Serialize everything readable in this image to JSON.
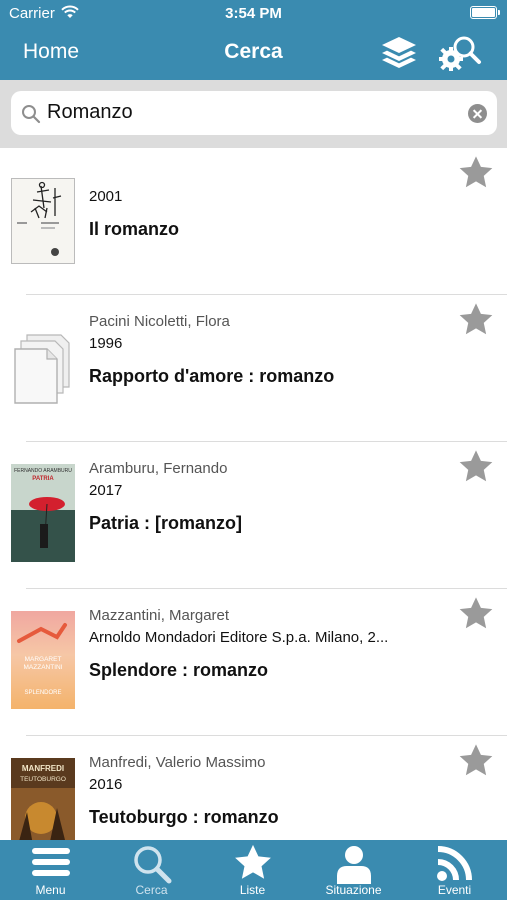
{
  "status_bar": {
    "carrier": "Carrier",
    "time": "3:54 PM"
  },
  "nav": {
    "back_label": "Home",
    "title": "Cerca"
  },
  "search": {
    "value": "Romanzo"
  },
  "results": [
    {
      "author": "",
      "year": "2001",
      "title": "Il romanzo"
    },
    {
      "author": "Pacini Nicoletti, Flora",
      "year": "1996",
      "title": "Rapporto d'amore : romanzo"
    },
    {
      "author": "Aramburu, Fernando",
      "year": "2017",
      "title": "Patria : [romanzo]"
    },
    {
      "author": "Mazzantini, Margaret",
      "year": "Arnoldo Mondadori Editore S.p.a. Milano, 2...",
      "title": "Splendore : romanzo"
    },
    {
      "author": "Manfredi, Valerio Massimo",
      "year": "2016",
      "title": "Teutoburgo : romanzo"
    }
  ],
  "covers": {
    "c3_author": "FERNANDO ARAMBURU",
    "c3_title": "PATRIA",
    "c4_author_line1": "MARGARET",
    "c4_author_line2": "MAZZANTINI",
    "c4_title": "SPLENDORE",
    "c5_title_line1": "MANFREDI",
    "c5_title_line2": "TEUTOBURGO"
  },
  "tabs": [
    {
      "label": "Menu",
      "icon": "menu-icon"
    },
    {
      "label": "Cerca",
      "icon": "search-icon",
      "active": true
    },
    {
      "label": "Liste",
      "icon": "star-icon"
    },
    {
      "label": "Situazione",
      "icon": "person-icon"
    },
    {
      "label": "Eventi",
      "icon": "rss-icon"
    }
  ],
  "colors": {
    "bar": "#3a8bb0",
    "search_bg": "#dcdcdc",
    "star": "#9a9a9a"
  }
}
